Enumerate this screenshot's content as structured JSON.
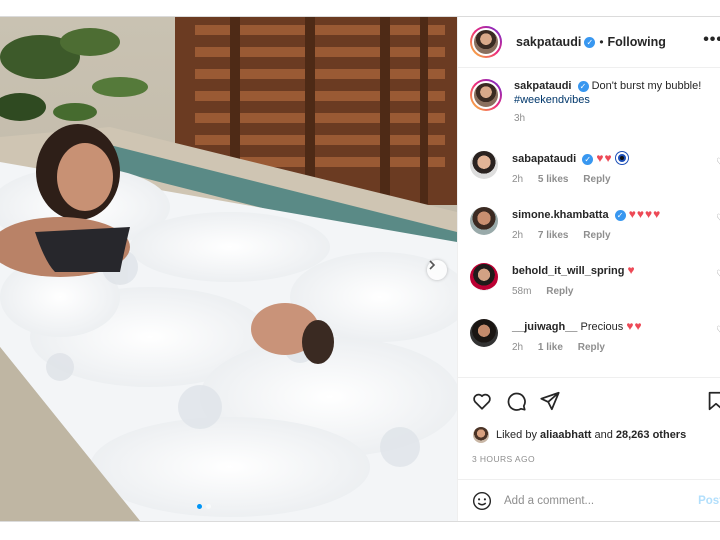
{
  "post": {
    "username": "sakpataudi",
    "follow_status": "Following",
    "separator": "•",
    "more_icon": "more-dots-icon",
    "caption": "Don't burst my bubble!",
    "hashtag": "#weekendvibes",
    "caption_age": "3h"
  },
  "comments": [
    {
      "user": "sabapataudi",
      "text": "",
      "emoji": "♥♥",
      "extra": "nazar-amulet",
      "age": "2h",
      "likes": "5 likes",
      "reply": "Reply"
    },
    {
      "user": "simone.khambatta",
      "text": "",
      "emoji": "♥♥♥♥",
      "age": "2h",
      "likes": "7 likes",
      "reply": "Reply"
    },
    {
      "user": "behold_it_will_spring",
      "text": "",
      "emoji": "♥",
      "age": "58m",
      "reply": "Reply"
    },
    {
      "user": "__juiwagh__",
      "text": "Precious",
      "emoji": "♥♥",
      "age": "2h",
      "likes": "1 like",
      "reply": "Reply"
    }
  ],
  "actions": {
    "liked_by_prefix": "Liked by",
    "liked_by_user": "aliaabhatt",
    "liked_by_and": "and",
    "liked_by_count": "28,263 others",
    "timestamp": "3 HOURS AGO"
  },
  "composer": {
    "placeholder": "Add a comment...",
    "post_label": "Post"
  },
  "colors": {
    "link": "#00376b",
    "verified": "#3897f0",
    "heart": "#ed4956",
    "muted": "#8e8e8e"
  }
}
